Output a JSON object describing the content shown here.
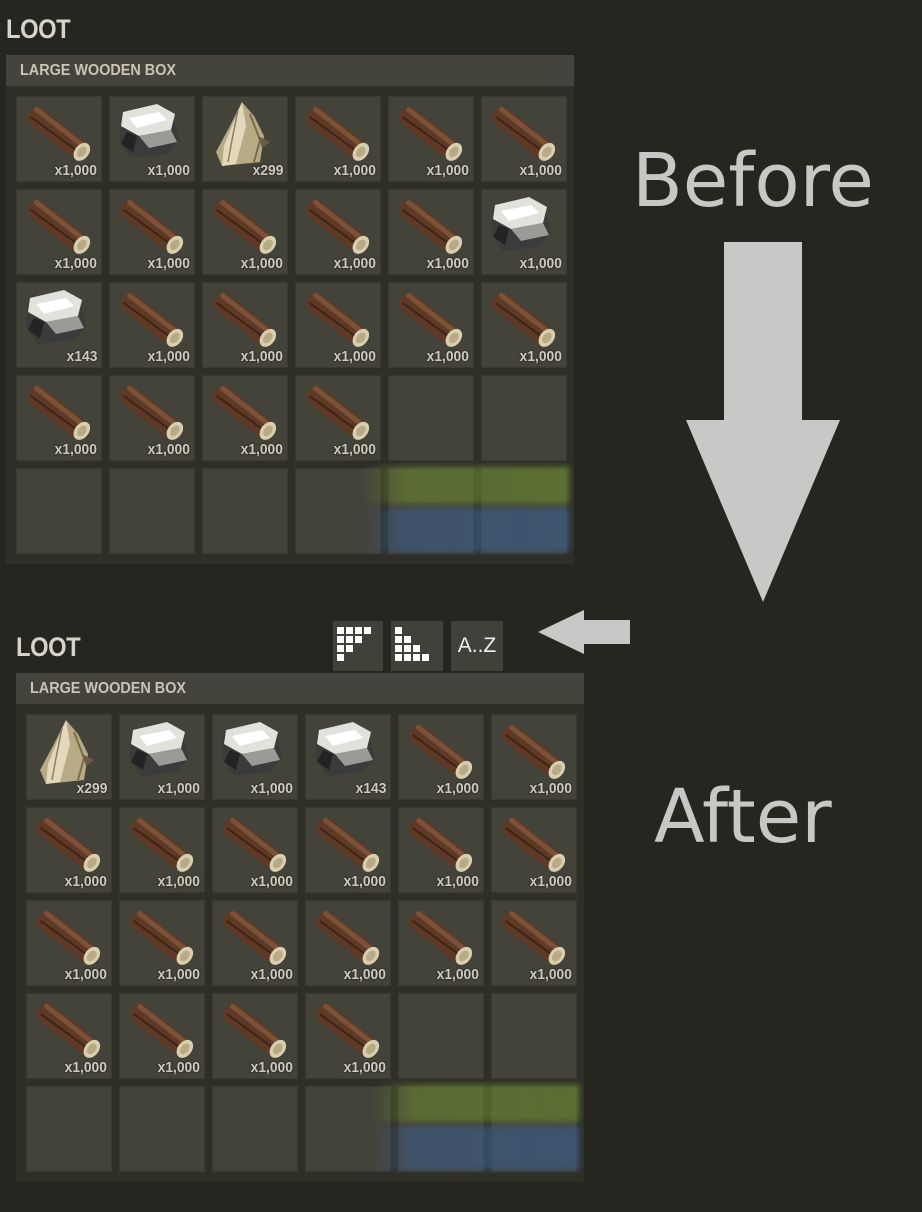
{
  "before": {
    "panel_title": "LOOT",
    "container_name": "LARGE WOODEN BOX",
    "slots": [
      {
        "item": "wood",
        "qty": "x1,000"
      },
      {
        "item": "stones",
        "qty": "x1,000"
      },
      {
        "item": "cloth",
        "qty": "x299"
      },
      {
        "item": "wood",
        "qty": "x1,000"
      },
      {
        "item": "wood",
        "qty": "x1,000"
      },
      {
        "item": "wood",
        "qty": "x1,000"
      },
      {
        "item": "wood",
        "qty": "x1,000"
      },
      {
        "item": "wood",
        "qty": "x1,000"
      },
      {
        "item": "wood",
        "qty": "x1,000"
      },
      {
        "item": "wood",
        "qty": "x1,000"
      },
      {
        "item": "wood",
        "qty": "x1,000"
      },
      {
        "item": "stones",
        "qty": "x1,000"
      },
      {
        "item": "stones",
        "qty": "x143"
      },
      {
        "item": "wood",
        "qty": "x1,000"
      },
      {
        "item": "wood",
        "qty": "x1,000"
      },
      {
        "item": "wood",
        "qty": "x1,000"
      },
      {
        "item": "wood",
        "qty": "x1,000"
      },
      {
        "item": "wood",
        "qty": "x1,000"
      },
      {
        "item": "wood",
        "qty": "x1,000"
      },
      {
        "item": "wood",
        "qty": "x1,000"
      },
      {
        "item": "wood",
        "qty": "x1,000"
      },
      {
        "item": "wood",
        "qty": "x1,000"
      },
      {
        "item": "",
        "qty": ""
      },
      {
        "item": "",
        "qty": ""
      },
      {
        "item": "",
        "qty": ""
      },
      {
        "item": "",
        "qty": ""
      },
      {
        "item": "",
        "qty": ""
      },
      {
        "item": "",
        "qty": ""
      },
      {
        "item": "",
        "qty": ""
      },
      {
        "item": "",
        "qty": ""
      }
    ]
  },
  "after": {
    "panel_title": "LOOT",
    "container_name": "LARGE WOODEN BOX",
    "sort_buttons": [
      {
        "icon": "sort-fill-icon",
        "label": ""
      },
      {
        "icon": "sort-stack-icon",
        "label": ""
      },
      {
        "icon": "",
        "label": "A..Z"
      }
    ],
    "slots": [
      {
        "item": "cloth",
        "qty": "x299"
      },
      {
        "item": "stones",
        "qty": "x1,000"
      },
      {
        "item": "stones",
        "qty": "x1,000"
      },
      {
        "item": "stones",
        "qty": "x143"
      },
      {
        "item": "wood",
        "qty": "x1,000"
      },
      {
        "item": "wood",
        "qty": "x1,000"
      },
      {
        "item": "wood",
        "qty": "x1,000"
      },
      {
        "item": "wood",
        "qty": "x1,000"
      },
      {
        "item": "wood",
        "qty": "x1,000"
      },
      {
        "item": "wood",
        "qty": "x1,000"
      },
      {
        "item": "wood",
        "qty": "x1,000"
      },
      {
        "item": "wood",
        "qty": "x1,000"
      },
      {
        "item": "wood",
        "qty": "x1,000"
      },
      {
        "item": "wood",
        "qty": "x1,000"
      },
      {
        "item": "wood",
        "qty": "x1,000"
      },
      {
        "item": "wood",
        "qty": "x1,000"
      },
      {
        "item": "wood",
        "qty": "x1,000"
      },
      {
        "item": "wood",
        "qty": "x1,000"
      },
      {
        "item": "wood",
        "qty": "x1,000"
      },
      {
        "item": "wood",
        "qty": "x1,000"
      },
      {
        "item": "wood",
        "qty": "x1,000"
      },
      {
        "item": "wood",
        "qty": "x1,000"
      },
      {
        "item": "",
        "qty": ""
      },
      {
        "item": "",
        "qty": ""
      },
      {
        "item": "",
        "qty": ""
      },
      {
        "item": "",
        "qty": ""
      },
      {
        "item": "",
        "qty": ""
      },
      {
        "item": "",
        "qty": ""
      },
      {
        "item": "",
        "qty": ""
      },
      {
        "item": "",
        "qty": ""
      }
    ]
  },
  "annotations": {
    "before_label": "Before",
    "after_label": "After",
    "down_arrow_icon": "arrow-down-icon",
    "left_arrow_icon": "arrow-left-icon",
    "arrow_color": "#c8c8c6"
  },
  "colors": {
    "background": "#262620",
    "slot": "#44433a",
    "header_bar": "#45443c"
  }
}
